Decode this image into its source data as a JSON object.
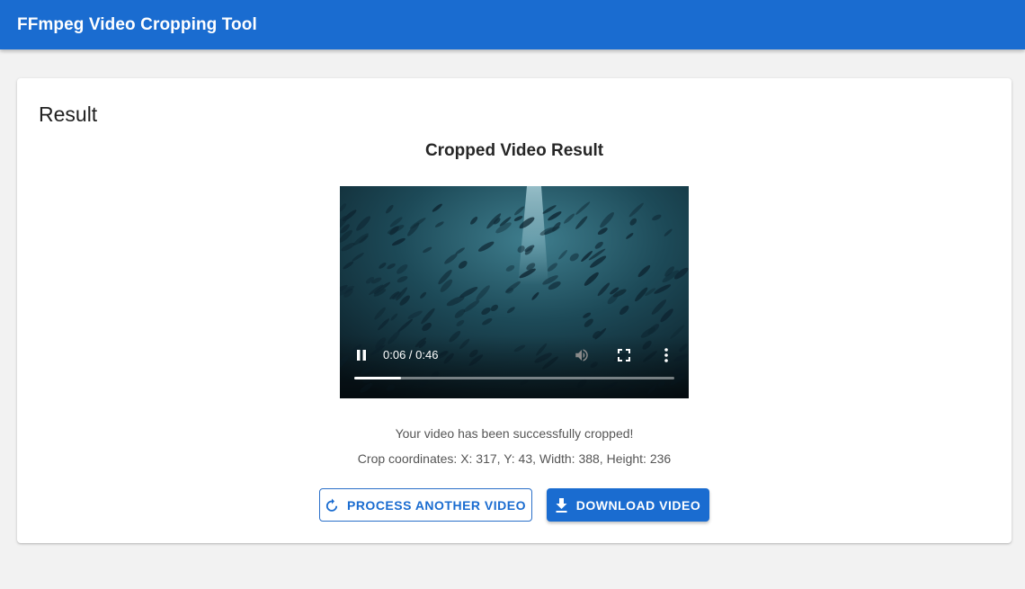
{
  "app": {
    "title": "FFmpeg Video Cropping Tool",
    "accent_color": "#1a6cd0"
  },
  "card": {
    "title": "Result",
    "heading": "Cropped Video Result"
  },
  "video": {
    "time_display": "0:06 / 0:46",
    "progress": 0.146,
    "state": "playing",
    "controls": {
      "pause_icon": "pause-icon",
      "mute_icon": "volume-icon",
      "fullscreen_icon": "fullscreen-icon",
      "more_icon": "more-vert-icon"
    }
  },
  "messages": {
    "success": "Your video has been successfully cropped!",
    "coordinates": "Crop coordinates: X: 317, Y: 43, Width: 388, Height: 236"
  },
  "actions": {
    "process_another_label": "PROCESS ANOTHER VIDEO",
    "process_another_icon": "replay-icon",
    "download_label": "DOWNLOAD VIDEO",
    "download_icon": "download-icon"
  }
}
